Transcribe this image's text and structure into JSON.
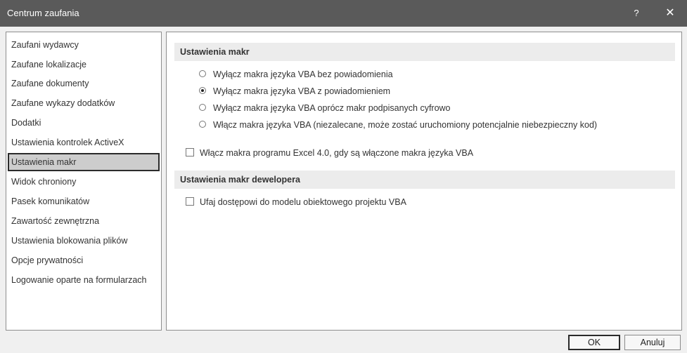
{
  "window": {
    "title": "Centrum zaufania",
    "help_label": "?",
    "close_label": "✕"
  },
  "nav": {
    "items": [
      {
        "label": "Zaufani wydawcy"
      },
      {
        "label": "Zaufane lokalizacje"
      },
      {
        "label": "Zaufane dokumenty"
      },
      {
        "label": "Zaufane wykazy dodatków"
      },
      {
        "label": "Dodatki"
      },
      {
        "label": "Ustawienia kontrolek ActiveX"
      },
      {
        "label": "Ustawienia makr",
        "selected": true
      },
      {
        "label": "Widok chroniony"
      },
      {
        "label": "Pasek komunikatów"
      },
      {
        "label": "Zawartość zewnętrzna"
      },
      {
        "label": "Ustawienia blokowania plików"
      },
      {
        "label": "Opcje prywatności"
      },
      {
        "label": "Logowanie oparte na formularzach"
      }
    ]
  },
  "macro_settings": {
    "heading": "Ustawienia makr",
    "options": [
      {
        "label": "Wyłącz makra języka VBA bez powiadomienia",
        "checked": false
      },
      {
        "label": "Wyłącz makra języka VBA z powiadomieniem",
        "checked": true
      },
      {
        "label": "Wyłącz makra języka VBA oprócz makr podpisanych cyfrowo",
        "checked": false
      },
      {
        "label": "Włącz makra języka VBA (niezalecane, może zostać uruchomiony potencjalnie niebezpieczny kod)",
        "checked": false
      }
    ],
    "excel4_checkbox": {
      "label": "Włącz makra programu Excel 4.0, gdy są włączone makra języka VBA",
      "checked": false
    }
  },
  "developer_settings": {
    "heading": "Ustawienia makr dewelopera",
    "vba_access_checkbox": {
      "label": "Ufaj dostępowi do modelu obiektowego projektu VBA",
      "checked": false
    }
  },
  "footer": {
    "ok_label": "OK",
    "cancel_label": "Anuluj"
  }
}
